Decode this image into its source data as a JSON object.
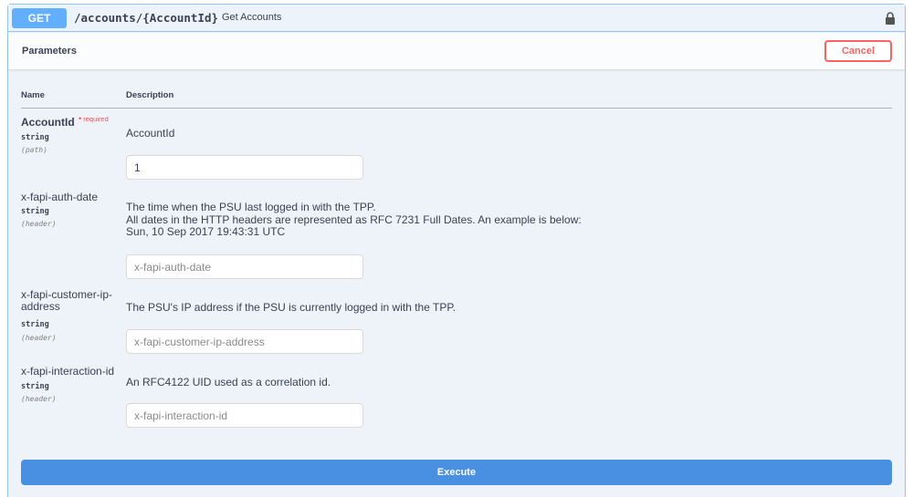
{
  "operation": {
    "method": "GET",
    "path": "/accounts/{AccountId}",
    "summary": "Get Accounts",
    "lock_icon": "lock-icon"
  },
  "parameters_section": {
    "title": "Parameters",
    "cancel_label": "Cancel",
    "columns": {
      "name": "Name",
      "description": "Description"
    }
  },
  "params": [
    {
      "name": "AccountId",
      "required_label": "required",
      "type": "string",
      "in": "(path)",
      "description": "AccountId",
      "value": "1",
      "placeholder": ""
    },
    {
      "name": "x-fapi-auth-date",
      "type": "string",
      "in": "(header)",
      "description_lines": [
        "The time when the PSU last logged in with the TPP.",
        "All dates in the HTTP headers are represented as RFC 7231 Full Dates. An example is below:",
        "Sun, 10 Sep 2017 19:43:31 UTC"
      ],
      "value": "",
      "placeholder": "x-fapi-auth-date"
    },
    {
      "name_line1": "x-fapi-customer-ip-",
      "name_line2": "address",
      "type": "string",
      "in": "(header)",
      "description": "The PSU's IP address if the PSU is currently logged in with the TPP.",
      "value": "",
      "placeholder": "x-fapi-customer-ip-address"
    },
    {
      "name": "x-fapi-interaction-id",
      "type": "string",
      "in": "(header)",
      "description": "An RFC4122 UID used as a correlation id.",
      "value": "",
      "placeholder": "x-fapi-interaction-id"
    }
  ],
  "execute_label": "Execute",
  "colors": {
    "get_method": "#61affe",
    "block_border": "#93c4f6",
    "block_bg": "#eef3f9",
    "cancel": "#ff6060",
    "execute": "#4990e2",
    "required": "#ff4949"
  }
}
